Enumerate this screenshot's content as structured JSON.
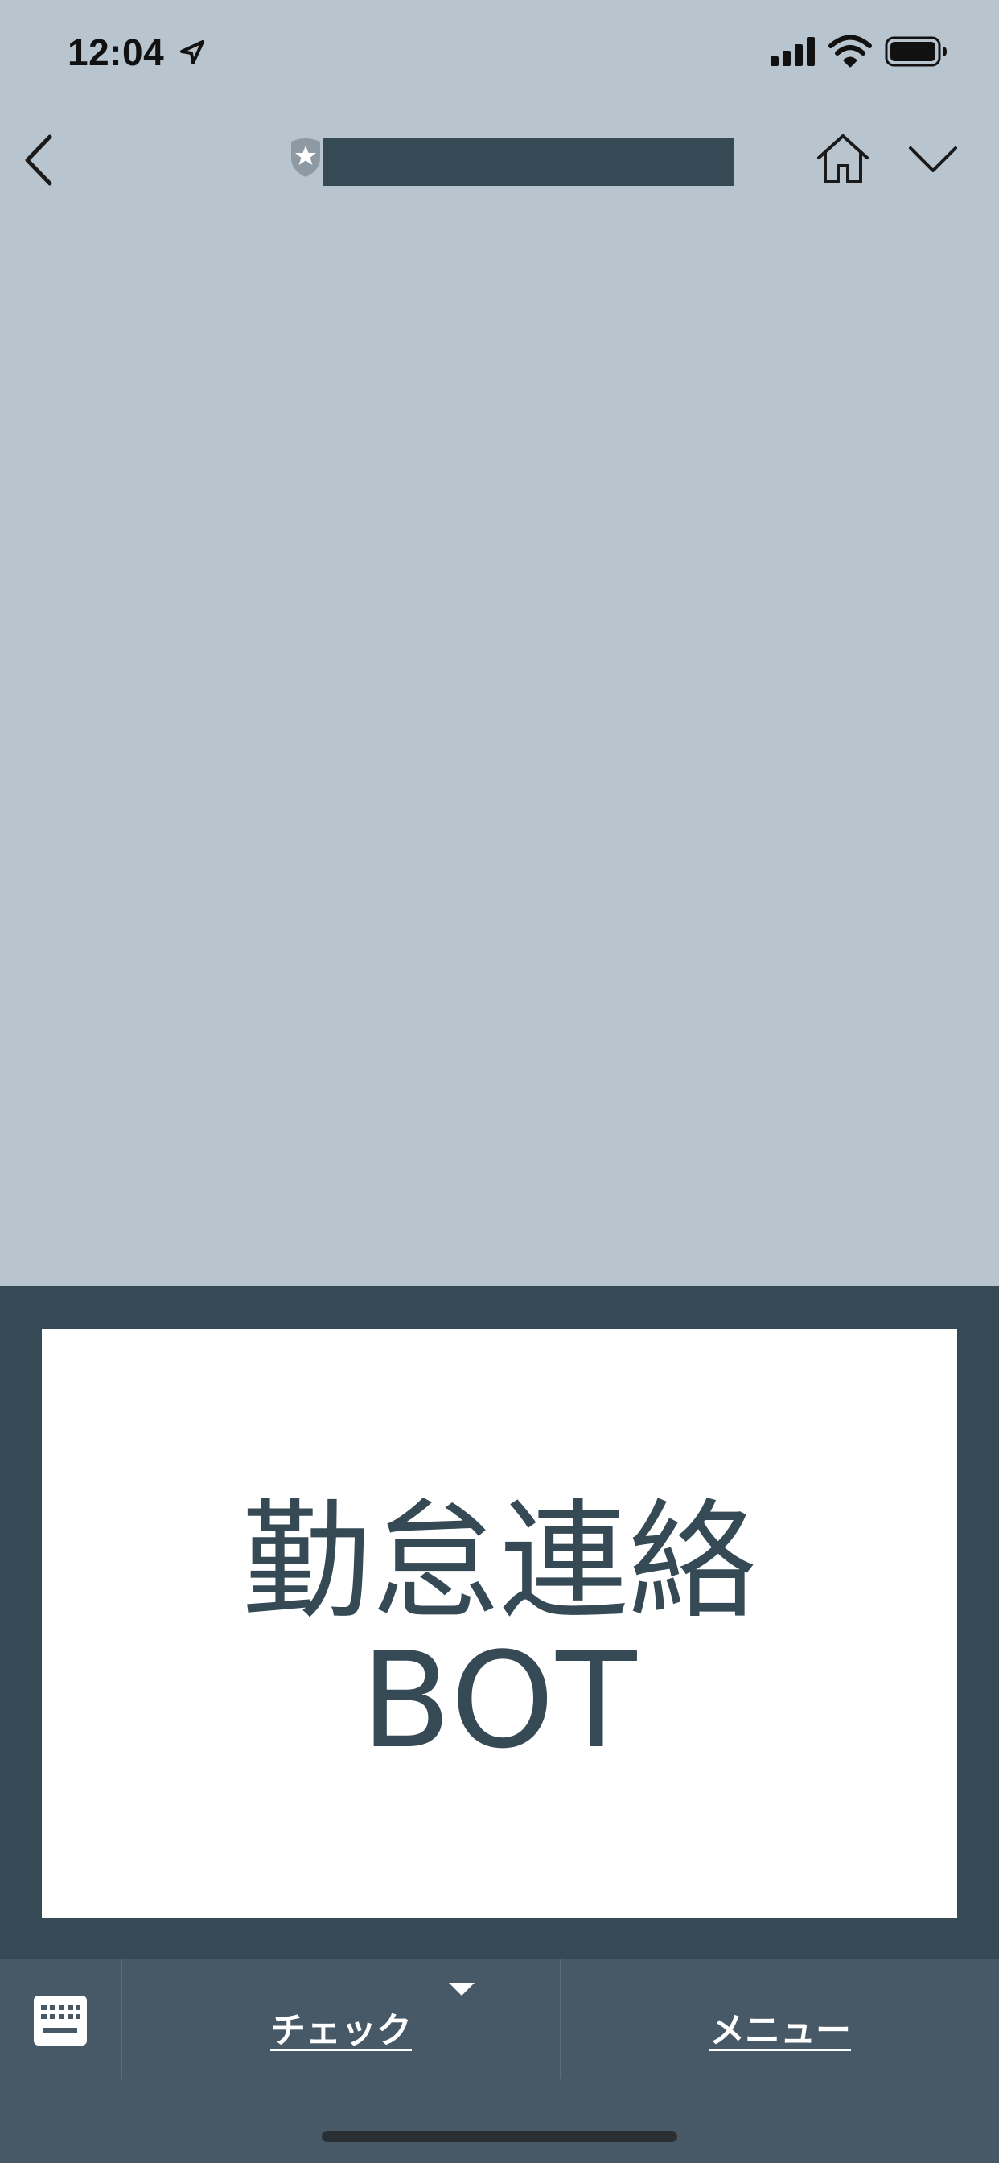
{
  "status_bar": {
    "time": "12:04",
    "icons": [
      "location-arrow-icon",
      "cellular-signal-icon",
      "wifi-icon",
      "battery-icon"
    ]
  },
  "nav_bar": {
    "title": "",
    "icons": [
      "back-chevron-icon",
      "official-account-badge-icon",
      "home-icon",
      "chevron-down-icon"
    ]
  },
  "rich_menu": {
    "line1": "勤怠連絡",
    "line2": "BOT"
  },
  "bottom_bar": {
    "tabs": [
      {
        "label": "チェック",
        "selected": true
      },
      {
        "label": "メニュー",
        "selected": false
      }
    ],
    "icons": [
      "keyboard-icon",
      "caret-up-icon"
    ]
  },
  "colors": {
    "background": "#b9c5ce",
    "rich_menu_bg": "#364a56",
    "bottom_bar_bg": "#475966",
    "text_dark": "#364a56",
    "white": "#ffffff"
  }
}
